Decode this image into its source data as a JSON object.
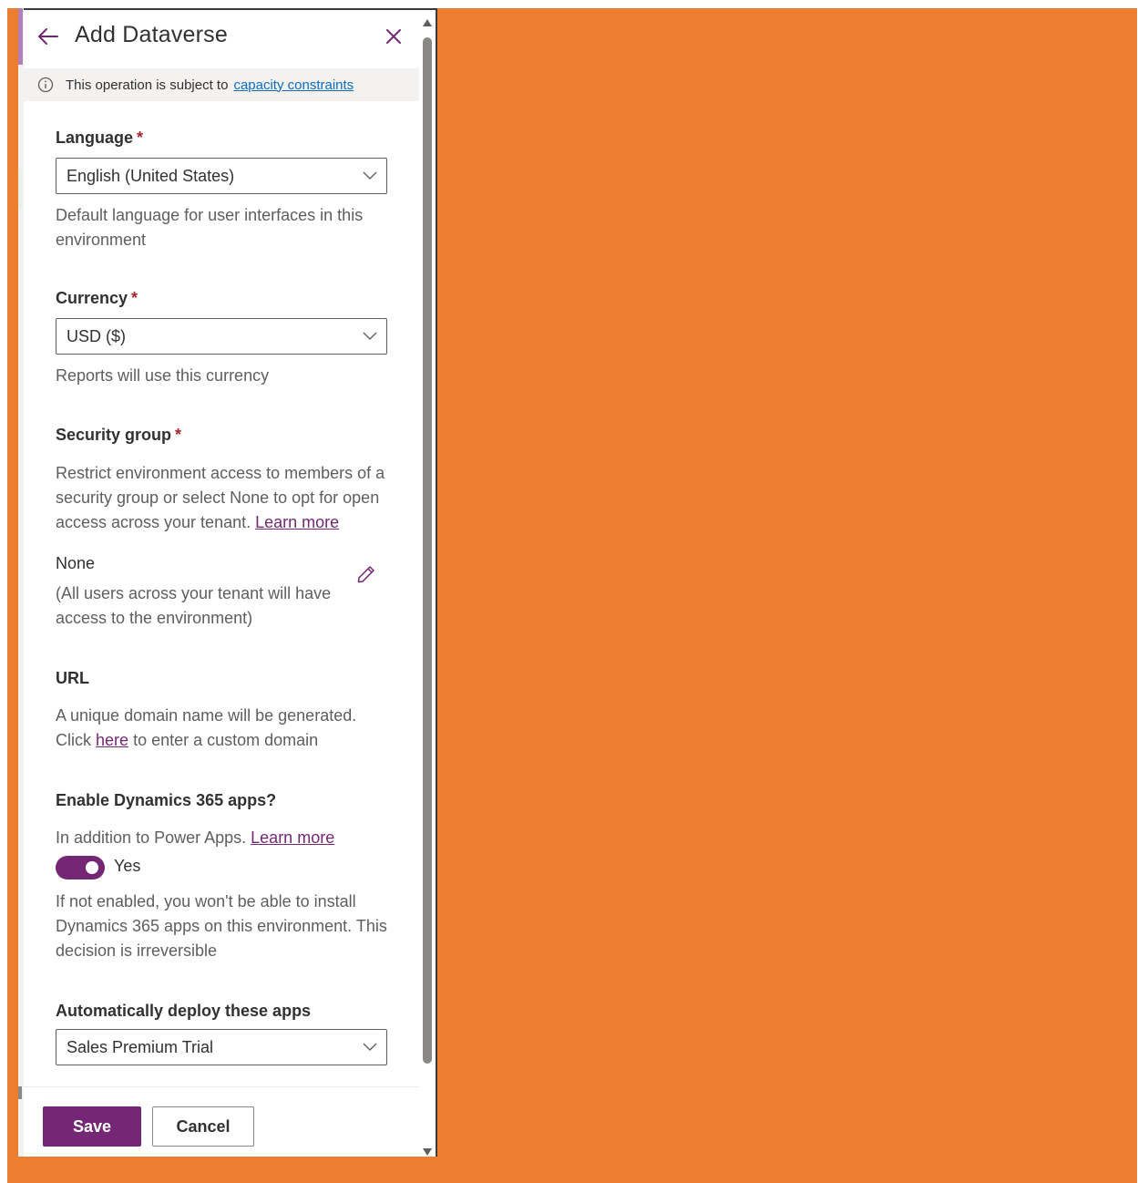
{
  "panel": {
    "title": "Add Dataverse",
    "icons": {
      "back": "arrow-left-icon",
      "close": "close-icon"
    }
  },
  "info_bar": {
    "text": "This operation is subject to",
    "link": "capacity constraints",
    "icon": "info-icon"
  },
  "language": {
    "label": "Language",
    "required": "*",
    "value": "English (United States)",
    "help": "Default language for user interfaces in this environment"
  },
  "currency": {
    "label": "Currency",
    "required": "*",
    "value": "USD ($)",
    "help": "Reports will use this currency"
  },
  "security_group": {
    "label": "Security group",
    "required": "*",
    "help": "Restrict environment access to members of a security group or select None to opt for open access across your tenant.",
    "help_link": "Learn more",
    "value": "None",
    "value_note": "(All users across your tenant will have access to the environment)",
    "edit_icon": "pencil-icon"
  },
  "url": {
    "label": "URL",
    "help_line1": "A unique domain name will be generated.",
    "help_pre": "Click",
    "help_link": "here",
    "help_post": "to enter a custom domain"
  },
  "dynamics": {
    "label": "Enable Dynamics 365 apps?",
    "help": "In addition to Power Apps.",
    "help_link": "Learn more",
    "toggle_label": "Yes",
    "toggle_on": true,
    "warning": "If not enabled, you won't be able to install Dynamics 365 apps on this environment. This decision is irreversible"
  },
  "deploy": {
    "label": "Automatically deploy these apps",
    "value": "Sales Premium Trial"
  },
  "footer": {
    "save_label": "Save",
    "cancel_label": "Cancel"
  },
  "colors": {
    "accent": "#742774",
    "background": "#ed7d31",
    "link_blue": "#0f6cbd",
    "required": "#a4262c"
  }
}
